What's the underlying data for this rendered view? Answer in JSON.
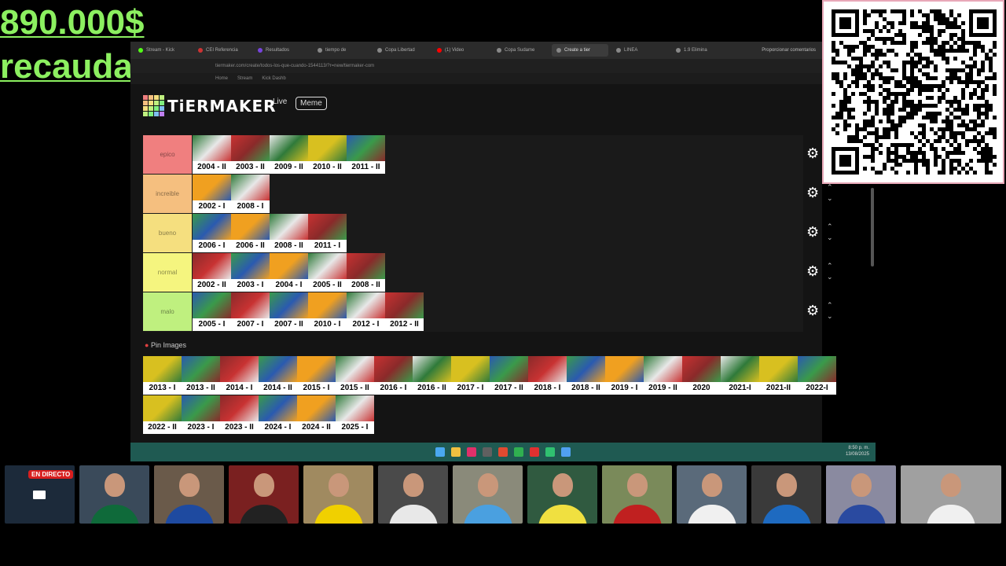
{
  "overlay": {
    "line1": "890.000$",
    "line2": "recaudados",
    "color": "#8cf060"
  },
  "qr": {
    "icon": "qr-code-icon"
  },
  "browser": {
    "tabs": [
      {
        "label": "Stream - Kick",
        "color": "#53fc18"
      },
      {
        "label": "CEI Referencia",
        "color": "#cc3333"
      },
      {
        "label": "Resultados",
        "color": "#7744dd"
      },
      {
        "label": "tiempo de",
        "color": "#888888"
      },
      {
        "label": "Copa Libertad",
        "color": "#888888"
      },
      {
        "label": "(1) Video",
        "color": "#ff0000"
      },
      {
        "label": "Copa Sudame",
        "color": "#888888"
      },
      {
        "label": "Create a tier",
        "color": "#888888",
        "active": true
      },
      {
        "label": "LINEA",
        "color": "#888888"
      },
      {
        "label": "1.9 Elimina",
        "color": "#888888"
      }
    ],
    "right_text": "Proporcionar comentarios",
    "address": "tiermaker.com/create/todos-los-que-cuando-1544113/?r=new/tiermaker-com",
    "bookmarks": [
      "Home",
      "Stream",
      "Kick Dashb"
    ]
  },
  "tiermaker": {
    "logo": "TiERMAKER",
    "nav_live": "Live",
    "nav_meme": "Meme",
    "pin_label": "Pin Images",
    "tiers": [
      {
        "label": "epico",
        "color": "#f07f7f",
        "items": [
          "2004 - II",
          "2003 - II",
          "2009 - II",
          "2010 - II",
          "2011 - II"
        ]
      },
      {
        "label": "increible",
        "color": "#f5bf7f",
        "items": [
          "2002 - I",
          "2008 - I"
        ]
      },
      {
        "label": "bueno",
        "color": "#f5df7f",
        "items": [
          "2006 - I",
          "2006 - II",
          "2008 - II",
          "2011 - I"
        ]
      },
      {
        "label": "normal",
        "color": "#f5f57f",
        "items": [
          "2002 - II",
          "2003 - I",
          "2004 - I",
          "2005 - II",
          "2008 - II"
        ]
      },
      {
        "label": "malo",
        "color": "#bff07f",
        "items": [
          "2005 - I",
          "2007 - I",
          "2007 - II",
          "2010 - I",
          "2012 - I",
          "2012 - II"
        ]
      }
    ],
    "pool_row1": [
      "2013 - I",
      "2013 - II",
      "2014 - I",
      "2014 - II",
      "2015 - I",
      "2015 - II",
      "2016 - I",
      "2016 - II",
      "2017 - I",
      "2017 - II",
      "2018 - I",
      "2018 - II",
      "2019 - I",
      "2019 - II",
      "2020",
      "2021-I",
      "2021-II",
      "2022-I"
    ],
    "pool_row2": [
      "2022 - II",
      "2023 - I",
      "2023 - II",
      "2024 - I",
      "2024 - II",
      "2025 - I"
    ]
  },
  "taskbar": {
    "time": "8:50 p. m.",
    "date": "13/08/2025",
    "icons": [
      "windows-start-icon",
      "file-explorer-icon",
      "tiktok-icon",
      "obs-icon",
      "chrome-icon",
      "spotify-icon",
      "app-red-icon",
      "app-green-icon",
      "app-blue-icon"
    ]
  },
  "live_badge": "EN DIRECTO",
  "cams": [
    {
      "name": "cam-1",
      "bg": "#1c2a3a",
      "shirt": "#333333"
    },
    {
      "name": "cam-2",
      "bg": "#3a4a5a",
      "shirt": "#0f6a3a"
    },
    {
      "name": "cam-3",
      "bg": "#6a5a4a",
      "shirt": "#1e4aa0"
    },
    {
      "name": "cam-4",
      "bg": "#7a2020",
      "shirt": "#222222"
    },
    {
      "name": "cam-5",
      "bg": "#a08a60",
      "shirt": "#f0d000"
    },
    {
      "name": "cam-6",
      "bg": "#4a4a4a",
      "shirt": "#e8e8e8"
    },
    {
      "name": "cam-7",
      "bg": "#8a8a7a",
      "shirt": "#4aa0e0"
    },
    {
      "name": "cam-8",
      "bg": "#305a40",
      "shirt": "#f0e040"
    },
    {
      "name": "cam-9",
      "bg": "#7a8a5a",
      "shirt": "#c02020"
    },
    {
      "name": "cam-10",
      "bg": "#5a6a7a",
      "shirt": "#f0f0f0"
    },
    {
      "name": "cam-11",
      "bg": "#3a3a3a",
      "shirt": "#1e6ac0"
    },
    {
      "name": "cam-12",
      "bg": "#8a8aa0",
      "shirt": "#2a4aa0"
    },
    {
      "name": "cam-13",
      "bg": "#a0a0a0",
      "shirt": "#f0f0f0"
    }
  ]
}
